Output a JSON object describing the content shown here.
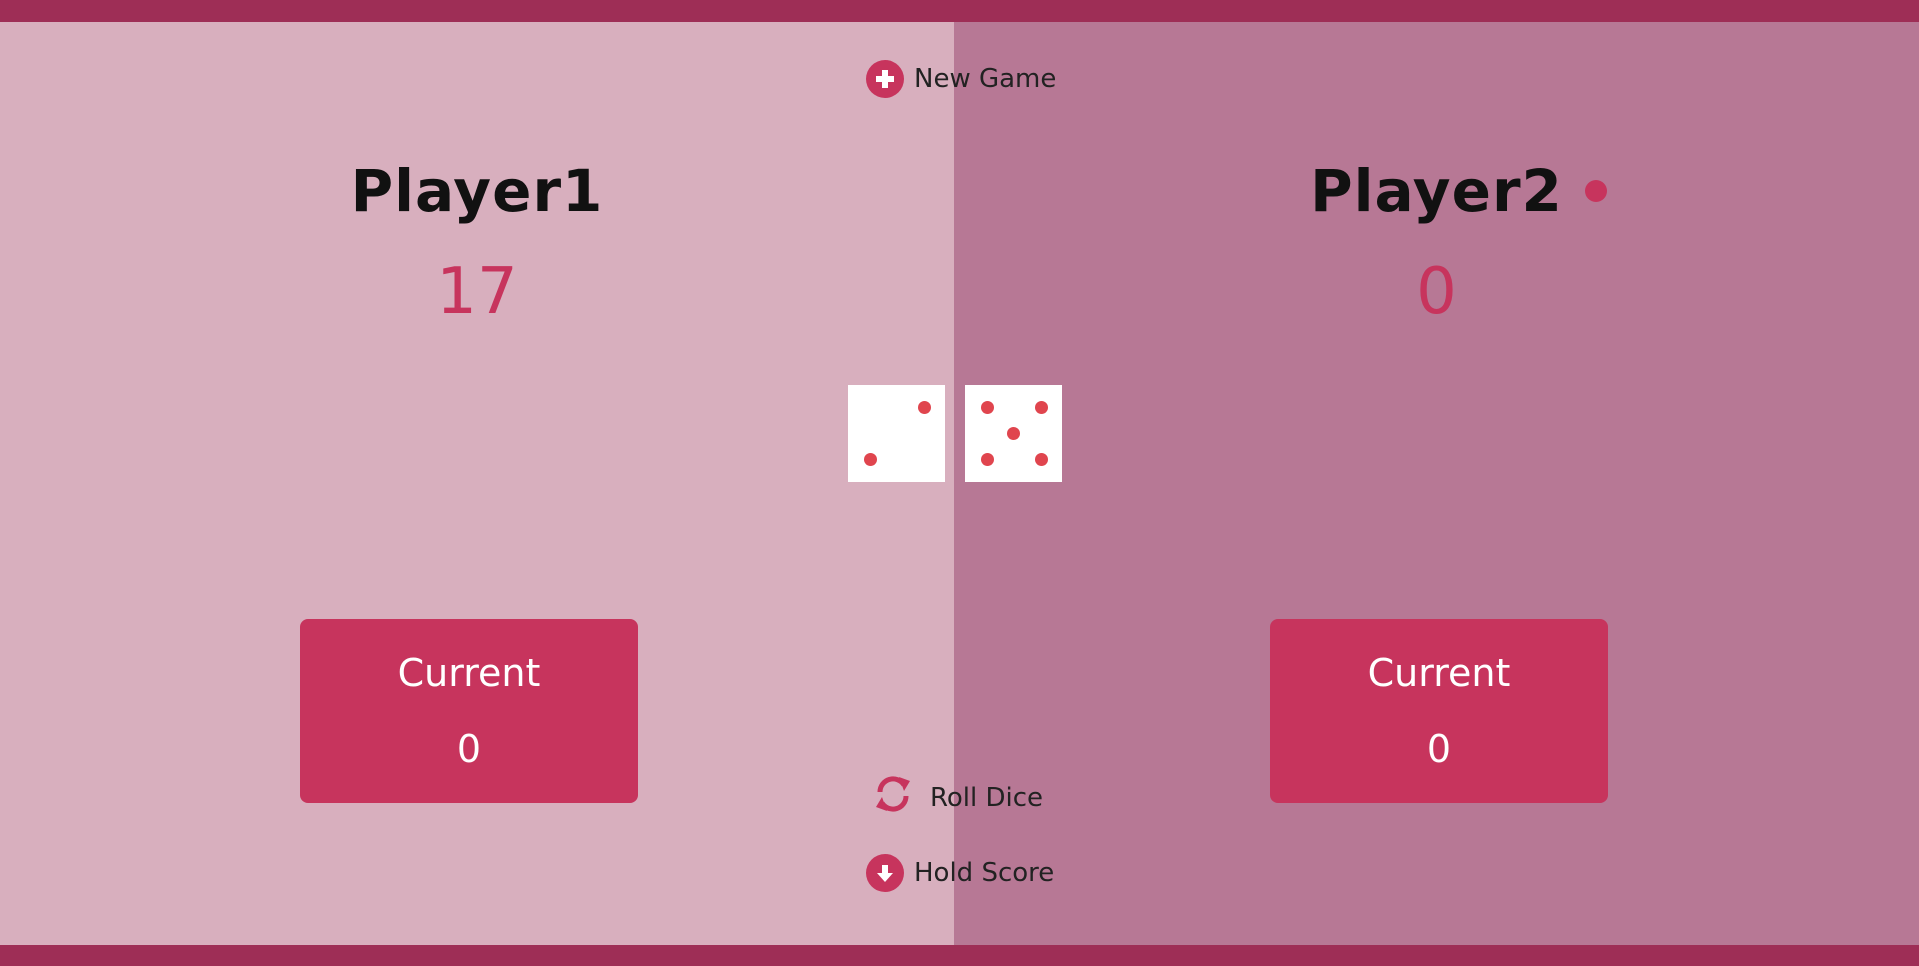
{
  "controls": {
    "new_game": "New Game",
    "roll_dice": "Roll Dice",
    "hold_score": "Hold Score"
  },
  "players": [
    {
      "name": "Player1",
      "score": "17",
      "current_label": "Current",
      "current_value": "0",
      "active": false
    },
    {
      "name": "Player2",
      "score": "0",
      "current_label": "Current",
      "current_value": "0",
      "active": true
    }
  ],
  "dice": [
    2,
    5
  ],
  "icons": {
    "new_game": "plus-circle-icon",
    "roll_dice": "refresh-icon",
    "hold_score": "arrow-down-circle-icon",
    "active_player": "dot-icon"
  },
  "colors": {
    "accent": "#c7345d",
    "frame": "#9e2e56",
    "panel_left": "#d8afbe",
    "panel_right": "#b77895",
    "pip": "#e0454e"
  }
}
